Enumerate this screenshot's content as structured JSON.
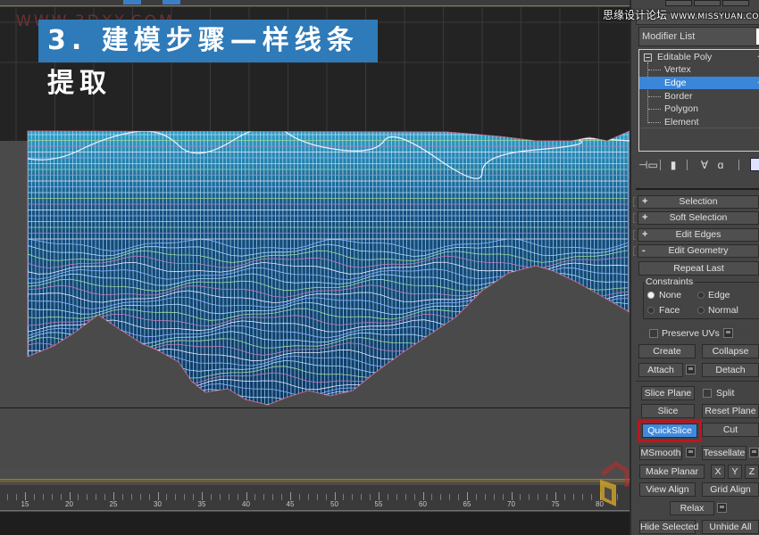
{
  "banner": {
    "title": "3. 建模步骤—样线条提取",
    "url_watermark": "WWW.3DXY.COM"
  },
  "site_watermark": {
    "cn": "思缘设计论坛",
    "url": "WWW.MISSYUAN.COM"
  },
  "colors": {
    "accent_blue": "#3f8ae0",
    "banner_blue": "#2f7ab8",
    "highlight_red": "#c1141c",
    "viewport_bg": "#232323",
    "panel_bg": "#444444"
  },
  "modifier_panel": {
    "modifier_list_label": "Modifier List",
    "stack": {
      "root": "Editable Poly",
      "items": [
        "Vertex",
        "Edge",
        "Border",
        "Polygon",
        "Element"
      ],
      "selected": "Edge"
    },
    "stack_tools": [
      {
        "icon": "pin-stack-icon",
        "glyph": "⊣"
      },
      {
        "icon": "show-end-result-icon",
        "glyph": "▮"
      },
      {
        "icon": "make-unique-icon",
        "glyph": "∀"
      },
      {
        "icon": "remove-modifier-icon",
        "glyph": "🗑"
      },
      {
        "icon": "configure-modifier-sets-icon",
        "glyph": ""
      }
    ]
  },
  "rollouts": [
    {
      "label": "Selection",
      "sign": "+"
    },
    {
      "label": "Soft Selection",
      "sign": "+"
    },
    {
      "label": "Edit Edges",
      "sign": "+"
    },
    {
      "label": "Edit Geometry",
      "sign": "-"
    }
  ],
  "edit_geometry": {
    "repeat_last": "Repeat Last",
    "constraints": {
      "title": "Constraints",
      "options": [
        "None",
        "Edge",
        "Face",
        "Normal"
      ],
      "selected": "None"
    },
    "preserve_uvs": {
      "label": "Preserve UVs",
      "checked": false
    },
    "create": "Create",
    "collapse": "Collapse",
    "attach": "Attach",
    "detach": "Detach",
    "slice_plane": "Slice Plane",
    "split": {
      "label": "Split",
      "checked": false
    },
    "slice": "Slice",
    "reset_plane": "Reset Plane",
    "quickslice": "QuickSlice",
    "cut": "Cut",
    "msmooth": "MSmooth",
    "tessellate": "Tessellate",
    "make_planar": "Make Planar",
    "x": "X",
    "y": "Y",
    "z": "Z",
    "view_align": "View Align",
    "grid_align": "Grid Align",
    "relax": "Relax",
    "hide_selected": "Hide Selected",
    "unhide_all": "Unhide All"
  },
  "timeline": {
    "labels": [
      "15",
      "20",
      "25",
      "30",
      "35",
      "40",
      "45",
      "50",
      "55",
      "60",
      "65",
      "70",
      "75",
      "80"
    ]
  }
}
